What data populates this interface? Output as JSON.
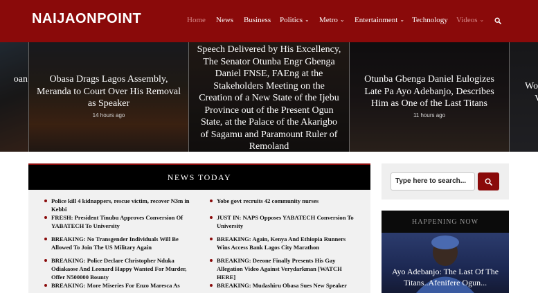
{
  "site": {
    "logo": "NAIJAONPOINT"
  },
  "nav": {
    "items": [
      {
        "label": "Home",
        "chevron": false
      },
      {
        "label": "News",
        "chevron": false
      },
      {
        "label": "Business",
        "chevron": false
      },
      {
        "label": "Politics",
        "chevron": true
      },
      {
        "label": "Metro",
        "chevron": true
      },
      {
        "label": "Entertainment",
        "chevron": true
      },
      {
        "label": "Technology",
        "chevron": false
      },
      {
        "label": "Videos",
        "chevron": true
      }
    ],
    "search_icon": "search-icon"
  },
  "slider": {
    "left_partial": "oan",
    "slides": [
      {
        "title": "Obasa Drags Lagos Assembly, Meranda to Court Over His Removal as Speaker",
        "time": "14 hours ago"
      },
      {
        "title": "Speech Delivered by His Excellency, The Senator Otunba Engr Gbenga Daniel FNSE, FAEng at the Stakeholders Meeting on the Creation of a New State of the Ijebu Province out of the Present Ogun State, at the Palace of the Akarigbo of Sagamu and Paramount Ruler of Remoland",
        "time": ""
      },
      {
        "title": "Otunba Gbenga Daniel Eulogizes Late Pa Ayo Adebanjo, Describes Him as One of the Last Titans",
        "time": "11 hours ago"
      }
    ],
    "right_partial_1": "Wo",
    "right_partial_2": "V"
  },
  "news_today": {
    "title": "NEWS TODAY",
    "left_column": [
      "Police kill 4 kidnappers, rescue victim, recover N3m in Kebbi",
      "FRESH: President Tinubu Approves Conversion Of YABATECH To University",
      "BREAKING: No Transgender Individuals Will Be Allowed To Join The US Military Again",
      "BREAKING: Police Declare Christopher Nduka Odiakaose And Leonard Happy Wanted For Murder, Offer N500000 Bounty",
      "BREAKING: More Miseries For Enzo Maresca As"
    ],
    "right_column": [
      "Yobe govt recruits 42 community nurses",
      "JUST IN: NAPS Opposes YABATECH Conversion To University",
      "BREAKING: Again, Kenya And Ethiopia Runners Wins Access Bank Lagos City Marathon",
      "BREAKING: Deeone Finally Presents His Gay Allegation Video Against Verydarkman [WATCH HERE]",
      "BREAKING: Mudashiru Obasa Sues New Speaker"
    ]
  },
  "search": {
    "placeholder": "Type here to search...",
    "button_icon": "search-icon"
  },
  "happening_now": {
    "title": "HAPPENING NOW",
    "story": "Ayo Adebanjo: The Last Of The Titans..Afenifere Ogun..."
  },
  "colors": {
    "brand": "#8a0a0a",
    "header_bg": "#8a0a0a",
    "news_box_bg": "#f1f1f1"
  }
}
